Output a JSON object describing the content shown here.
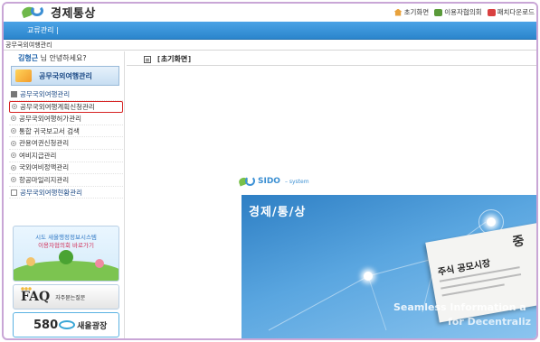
{
  "header": {
    "app_title": "경제통상",
    "util_links": [
      {
        "label": "초기화면",
        "icon": "home-icon"
      },
      {
        "label": "이용자협의회",
        "icon": "book-icon"
      },
      {
        "label": "패치다운로드",
        "icon": "download-icon"
      }
    ]
  },
  "nav": {
    "menu_label": "교류관리  |"
  },
  "breadcrumb": "공무국외여행관리",
  "sidebar": {
    "greeting_name": "김형근",
    "greeting_suffix": " 님 안녕하세요?",
    "section_title": "공무국외여행관리",
    "items": [
      {
        "label": "공무국외여행관리",
        "kind": "group"
      },
      {
        "label": "공무국외여행계획신청관리",
        "kind": "item",
        "selected": true
      },
      {
        "label": "공무국외여행허가관리",
        "kind": "item"
      },
      {
        "label": "통합 귀국보고서 검색",
        "kind": "item"
      },
      {
        "label": "관용여권신청관리",
        "kind": "item"
      },
      {
        "label": "여비지급관리",
        "kind": "item"
      },
      {
        "label": "국외여비정액관리",
        "kind": "item"
      },
      {
        "label": "항공마일리지관리",
        "kind": "item"
      },
      {
        "label": "공무국외여행현황관리",
        "kind": "group"
      }
    ],
    "banners": {
      "council_line1": "시도 새올행정정보시스템",
      "council_line2": "이용자협의회 바로가기",
      "faq_title": "FAQ",
      "faq_sub": "자주묻는질문",
      "sq_number": "580",
      "sq_label": "새올광장"
    }
  },
  "main": {
    "page_title": "[초기화면]",
    "sido_logo": "SIDO",
    "sido_suffix": "– system",
    "hero_title": "경제/통/상",
    "paper_headline": "주식 공모시장",
    "paper_big": "중",
    "slogan1": "Seamless Information a",
    "slogan2": "for Decentraliz"
  },
  "colors": {
    "nav_blue": "#2b85cc",
    "frame_purple": "#c9a6d6",
    "selected_border": "#d62424"
  }
}
